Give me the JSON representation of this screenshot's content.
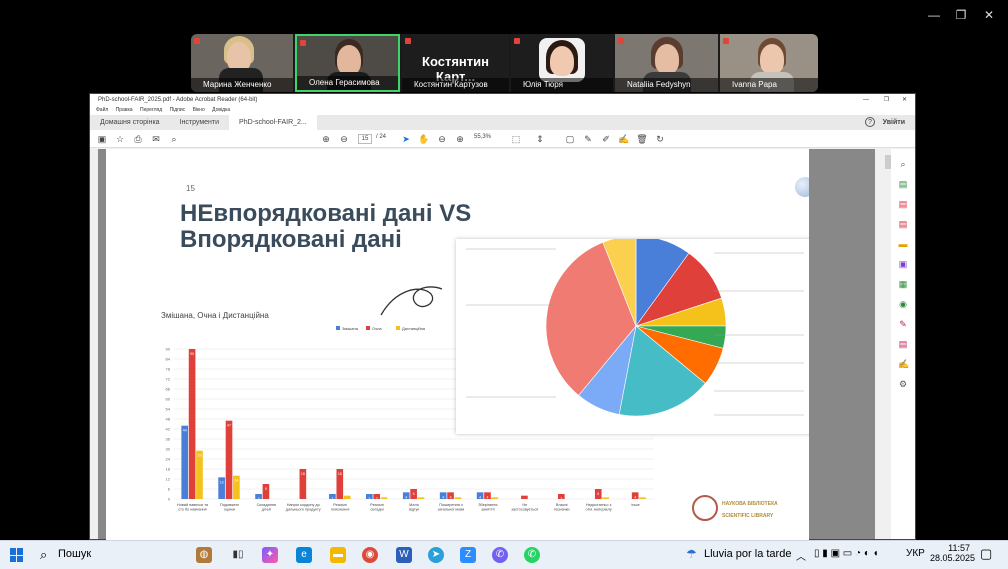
{
  "window_controls": {
    "minimize": "—",
    "restore": "❐",
    "close": "✕"
  },
  "meeting": {
    "participants": [
      {
        "name": "Марина Женченко"
      },
      {
        "name": "Олена Герасимова"
      },
      {
        "name": "Костянтин Картузов",
        "tile_label": "Костянтин Карт..."
      },
      {
        "name": "Юлія Тюря"
      },
      {
        "name": "Nataliia Fedyshyn"
      },
      {
        "name": "Ivanna Papa"
      }
    ],
    "active_speaker_color": "#3cd46b"
  },
  "acrobat": {
    "title": "PhD-school-FAIR_2025.pdf - Adobe Acrobat Reader (64-bit)",
    "menu": [
      "Файл",
      "Правка",
      "Перегляд",
      "Підпис",
      "Вікно",
      "Довідка"
    ],
    "tabs": [
      "Домашня сторінка",
      "Інструменти",
      "PhD-school-FAIR_2..."
    ],
    "signin": "Увійти",
    "page_current": "15",
    "page_total": "/ 24",
    "zoom": "55,3%"
  },
  "slide": {
    "number": "15",
    "title_line1": "НЕвпорядковані дані VS",
    "title_line2": "Впорядковані дані",
    "subtitle": "Змішана, Очна і Дистанційна",
    "logo_line1": "НАУКОВА БІБЛІОТЕКА",
    "logo_line2": "SCIENTIFIC LIBRARY",
    "accent": "#3a4b5c"
  },
  "chart_data": [
    {
      "type": "bar",
      "title": "",
      "series": [
        {
          "name": "Змішана",
          "color": "#4a7fd9",
          "values": [
            44,
            13,
            3,
            0,
            3,
            3,
            4,
            4,
            4,
            0,
            0,
            0,
            0
          ]
        },
        {
          "name": "Очна",
          "color": "#e0403a",
          "values": [
            90,
            47,
            9,
            18,
            18,
            3,
            6,
            4,
            4,
            2,
            3,
            6,
            4
          ]
        },
        {
          "name": "Дистанційна",
          "color": "#f5c21b",
          "values": [
            29,
            14,
            0,
            0,
            2,
            1,
            1,
            1,
            1,
            0,
            0,
            1,
            1
          ]
        }
      ],
      "categories": [
        "Новий навичок та сто бо навчання",
        "Подовжені оцінки",
        "Складання дітей",
        "Напряг кордону до дальнього продукту",
        "Реальні пояснення",
        "Реальні складні",
        "Мало відгук",
        "Поширення з загальної мови",
        "Зберігання заняття",
        "Не застосовується",
        "Власні позначки",
        "Недостатньо з отм. матеріалу",
        "Інше"
      ],
      "ylim": [
        0,
        90
      ],
      "yticks": [
        0,
        6,
        12,
        18,
        24,
        30,
        36,
        42,
        48,
        54,
        60,
        66,
        72,
        78,
        84,
        90
      ]
    },
    {
      "type": "pie",
      "slices": [
        {
          "color": "#4a7fd9",
          "value": 10
        },
        {
          "color": "#e0403a",
          "value": 10
        },
        {
          "color": "#f5c21b",
          "value": 5
        },
        {
          "color": "#34a853",
          "value": 4
        },
        {
          "color": "#ff6d01",
          "value": 7
        },
        {
          "color": "#46bdc6",
          "value": 17
        },
        {
          "color": "#7baaf7",
          "value": 8
        },
        {
          "color": "#f07b72",
          "value": 33
        },
        {
          "color": "#fcd04f",
          "value": 6
        }
      ]
    }
  ],
  "taskbar": {
    "search_label": "Пошук",
    "weather": "Lluvia por la tarde",
    "lang": "УКР",
    "time": "11:57",
    "date": "28.05.2025"
  }
}
